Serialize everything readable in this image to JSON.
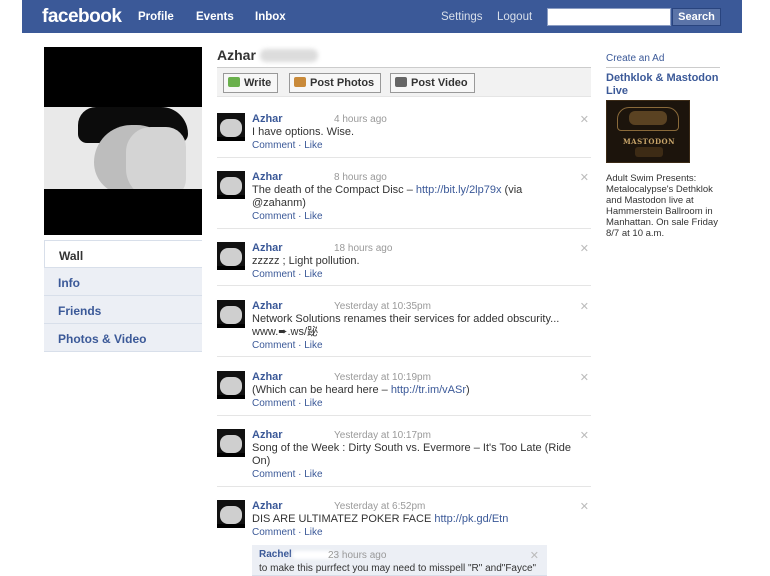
{
  "topbar": {
    "logo": "facebook",
    "nav": [
      "Profile",
      "Events",
      "Inbox"
    ],
    "settings": "Settings",
    "logout": "Logout",
    "search_placeholder": "",
    "search_button": "Search"
  },
  "sidebar": {
    "items": [
      {
        "label": "Wall",
        "active": true
      },
      {
        "label": "Info"
      },
      {
        "label": "Friends"
      },
      {
        "label": "Photos & Video"
      }
    ]
  },
  "profile": {
    "name": "Azhar"
  },
  "publisher": {
    "write": "Write",
    "post_photos": "Post Photos",
    "post_video": "Post Video"
  },
  "stories": [
    {
      "author": "Azhar",
      "time": "4 hours ago",
      "text": "I have options. Wise.",
      "link": "",
      "suffix": "",
      "actions": "Comment · Like"
    },
    {
      "author": "Azhar",
      "time": "8 hours ago",
      "text": "The death of the Compact Disc – ",
      "link": "http://bit.ly/2lp79x",
      "suffix": " (via @zahanm)",
      "actions": "Comment · Like"
    },
    {
      "author": "Azhar",
      "time": "18 hours ago",
      "text": "zzzzz ; Light pollution.",
      "link": "",
      "suffix": "",
      "actions": "Comment · Like"
    },
    {
      "author": "Azhar",
      "time": "Yesterday at 10:35pm",
      "text": "Network Solutions renames their services for added obscurity... www.➨.ws/䟤",
      "link": "",
      "suffix": "",
      "actions": "Comment · Like"
    },
    {
      "author": "Azhar",
      "time": "Yesterday at 10:19pm",
      "text": "(Which can be heard here – ",
      "link": "http://tr.im/vASr",
      "suffix": ")",
      "actions": "Comment · Like"
    },
    {
      "author": "Azhar",
      "time": "Yesterday at 10:17pm",
      "text": "Song of the Week : Dirty South vs. Evermore – It's Too Late (Ride On)",
      "link": "",
      "suffix": "",
      "actions": "Comment · Like"
    },
    {
      "author": "Azhar",
      "time": "Yesterday at 6:52pm",
      "text": "DIS ARE ULTIMATEZ POKER FACE ",
      "link": "http://pk.gd/Etn",
      "suffix": "",
      "actions": "Comment · Like"
    }
  ],
  "comment": {
    "author": "Rachel",
    "time": "23 hours ago",
    "text": "to make this purrfect you may need to misspell \"R\" and\"Fayce\""
  },
  "ads": {
    "create_ad": "Create an Ad",
    "title": "Dethklok & Mastodon Live",
    "image_label": "MASTODON",
    "text": "Adult Swim Presents: Metalocalypse's Dethklok and Mastodon live at Hammerstein Ballroom in Manhattan. On sale Friday 8/7 at 10 a.m."
  },
  "icons": {
    "close": "✕",
    "write": "speech-bubble-icon",
    "photo": "photo-icon",
    "video": "video-camera-icon"
  },
  "colors": {
    "brand": "#3b5998",
    "nav_bg": "#eceff5",
    "write_icon": "#6ab04c",
    "photo_icon": "#c98a3a",
    "video_icon": "#666666"
  }
}
